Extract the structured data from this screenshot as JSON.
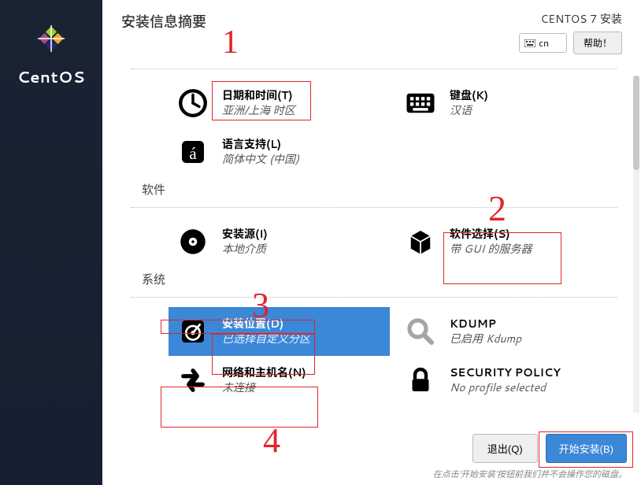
{
  "header": {
    "title": "安装信息摘要",
    "distro": "CENTOS 7 安装",
    "lang_indicator": "cn",
    "help_label": "帮助！"
  },
  "sidebar": {
    "logo_text": "CentOS"
  },
  "sections": {
    "localization": {
      "title": "",
      "datetime": {
        "title": "日期和时间(T)",
        "sub": "亚洲/上海 时区"
      },
      "keyboard": {
        "title": "键盘(K)",
        "sub": "汉语"
      },
      "language": {
        "title": "语言支持(L)",
        "sub": "简体中文 (中国)"
      }
    },
    "software": {
      "title": "软件",
      "source": {
        "title": "安装源(I)",
        "sub": "本地介质"
      },
      "selection": {
        "title": "软件选择(S)",
        "sub": "带 GUI 的服务器"
      }
    },
    "system": {
      "title": "系统",
      "destination": {
        "title": "安装位置(D)",
        "sub": "已选择自定义分区"
      },
      "kdump": {
        "title": "KDUMP",
        "sub": "已启用 Kdump"
      },
      "network": {
        "title": "网络和主机名(N)",
        "sub": "未连接"
      },
      "security": {
        "title": "SECURITY POLICY",
        "sub": "No profile selected"
      }
    }
  },
  "footer": {
    "quit": "退出(Q)",
    "begin": "开始安装(B)",
    "hint": "在点击'开始安装'按钮前我们并不会操作您的磁盘。"
  },
  "annotations": {
    "n1": "1",
    "n2": "2",
    "n3": "3",
    "n4": "4"
  }
}
